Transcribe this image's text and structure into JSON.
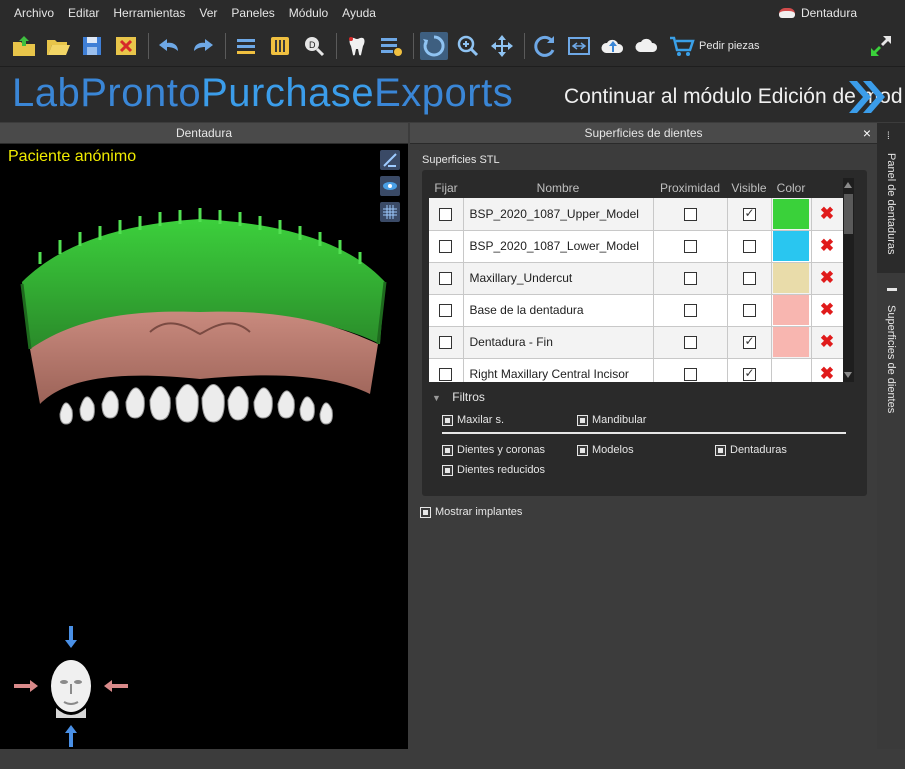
{
  "menu": {
    "items": [
      "Archivo",
      "Editar",
      "Herramientas",
      "Ver",
      "Paneles",
      "Módulo",
      "Ayuda"
    ],
    "module_name": "Dentadura"
  },
  "toolbar": {
    "order_label": "Pedir piezas"
  },
  "banner": {
    "brand_lab": "Lab",
    "brand_pronto": "Pronto",
    "brand_purchase": "Purchase",
    "brand_exports": "Exports",
    "continue_label": "Continuar al módulo Edición de mod"
  },
  "left_panel": {
    "title": "Dentadura",
    "patient": "Paciente anónimo"
  },
  "right_panel": {
    "title": "Superficies de dientes",
    "close_label": "×",
    "stl_label": "Superficies STL",
    "columns": [
      "Fijar",
      "Nombre",
      "Proximidad",
      "Visible",
      "Color"
    ],
    "rows": [
      {
        "name": "BSP_2020_1087_Upper_Model",
        "fix": false,
        "proximity": false,
        "visible": true,
        "color": "#3ad13a"
      },
      {
        "name": "BSP_2020_1087_Lower_Model",
        "fix": false,
        "proximity": false,
        "visible": false,
        "color": "#29c6f0"
      },
      {
        "name": "Maxillary_Undercut",
        "fix": false,
        "proximity": false,
        "visible": false,
        "color": "#e9dcaa"
      },
      {
        "name": "Base de la dentadura",
        "fix": false,
        "proximity": false,
        "visible": false,
        "color": "#f8b6b0"
      },
      {
        "name": "Dentadura - Fin",
        "fix": false,
        "proximity": false,
        "visible": true,
        "color": "#f8b6b0"
      },
      {
        "name": "Right Maxillary Central Incisor",
        "fix": false,
        "proximity": false,
        "visible": true,
        "color": "#ffffff"
      }
    ],
    "filters": {
      "title": "Filtros",
      "maxilar": "Maxilar s.",
      "mandibular": "Mandibular",
      "dientes_coronas": "Dientes y coronas",
      "modelos": "Modelos",
      "dentaduras": "Dentaduras",
      "dientes_reducidos": "Dientes reducidos"
    },
    "show_implants": "Mostrar implantes"
  },
  "side_tabs": {
    "tab1": "Panel de dentaduras",
    "tab2": "Superficies de dientes"
  },
  "colors": {
    "brand_blue": "#3a86d6",
    "accent_green": "#3ad13a",
    "patient_yellow": "#f0ec00",
    "delete_red": "#e01b1b"
  }
}
